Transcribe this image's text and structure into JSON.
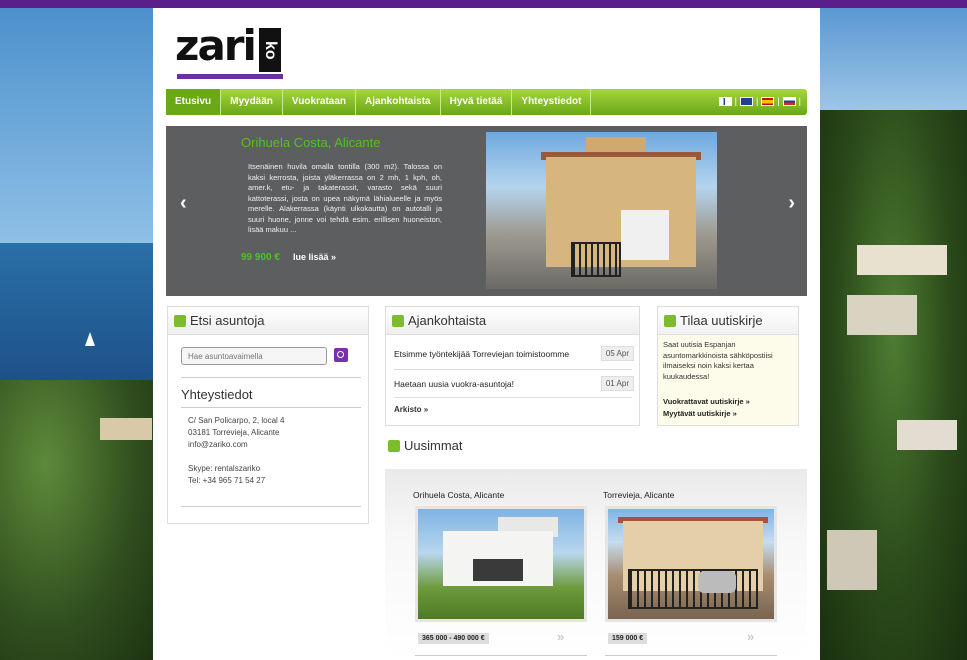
{
  "nav": {
    "items": [
      "Etusivu",
      "Myydään",
      "Vuokrataan",
      "Ajankohtaista",
      "Hyvä tietää",
      "Yhteystiedot"
    ]
  },
  "logo": {
    "text": "zari",
    "suffix": "ko"
  },
  "slider": {
    "title": "Orihuela Costa, Alicante",
    "description": "Itsenäinen huvila omalla tontilla (300 m2). Talossa on kaksi kerrosta, joista yläkerrassa on 2 mh, 1 kph, oh, amer.k, etu- ja takaterassit, varasto sekä suuri kattoterassi, josta on upea näkymä lähialueelle ja myös merelle. Alakerrassa (käynti ulkokautta) on autotalli ja suuri huone, jonne voi tehdä esim. erillisen huoneiston, lisää makuu ...",
    "price": "99 900 €",
    "read_more": "lue lisää »",
    "prev": "‹",
    "next": "›"
  },
  "search": {
    "title": "Etsi asuntoja",
    "placeholder": "Hae asuntoavaimella"
  },
  "contact": {
    "title": "Yhteystiedot",
    "address1": "C/ San Policarpo, 2, local 4",
    "address2": "03181 Torrevieja, Alicante",
    "email": "info@zariko.com",
    "skype": "Skype: rentalszariko",
    "phone": "Tel: +34 965 71 54 27"
  },
  "news": {
    "title": "Ajankohtaista",
    "items": [
      {
        "text": "Etsimme työntekijää Torreviejan toimistoomme",
        "date": "05 Apr"
      },
      {
        "text": "Haetaan uusia vuokra-asuntoja!",
        "date": "01 Apr"
      }
    ],
    "archive": "Arkisto »"
  },
  "newsletter": {
    "title": "Tilaa uutiskirje",
    "text": "Saat uutisia Espanjan asuntomarkkinoista sähköpostiisi ilmaiseksi noin kaksi kertaa kuukaudessa!",
    "link_rent": "Vuokrattavat uutiskirje »",
    "link_sale": "Myytävät uutiskirje »"
  },
  "newest": {
    "title": "Uusimmat",
    "cards": [
      {
        "location": "Orihuela Costa, Alicante",
        "price": "365 000 - 490 000 €"
      },
      {
        "location": "Torrevieja, Alicante",
        "price": "159 000 €"
      }
    ],
    "go": "»"
  },
  "colors": {
    "brand_purple": "#5b1f8b",
    "nav_green": "#7cbf1e",
    "accent_green": "#52c320",
    "slider_bg": "#5c5e60"
  }
}
